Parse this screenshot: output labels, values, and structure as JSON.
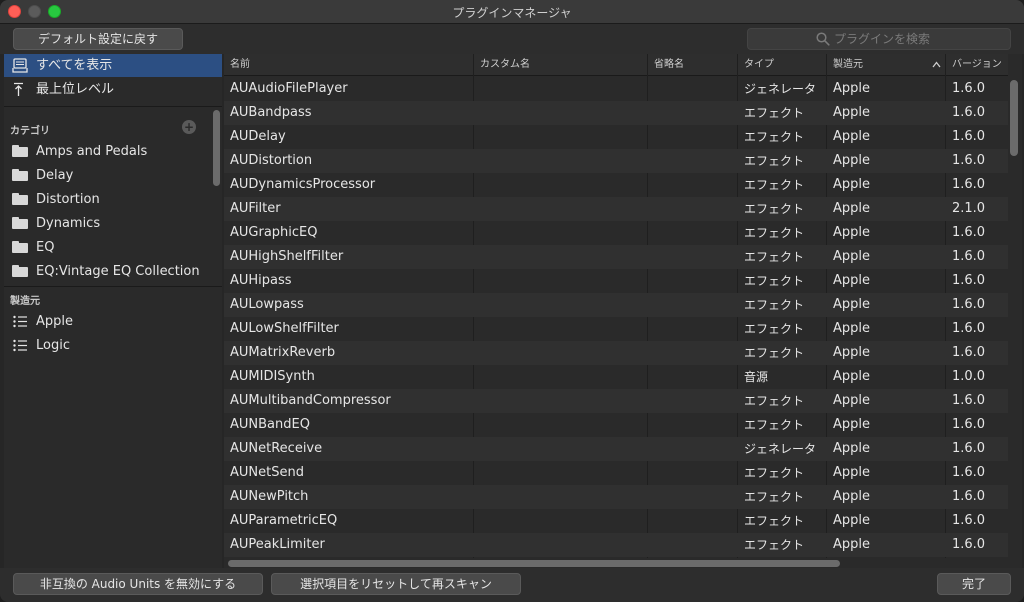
{
  "window": {
    "title": "プラグインマネージャ"
  },
  "toolbar": {
    "reset_label": "デフォルト設定に戻す",
    "search_placeholder": "プラグインを検索"
  },
  "sidebar": {
    "show_all": "すべてを表示",
    "top_level": "最上位レベル",
    "category_header": "カテゴリ",
    "categories": [
      "Amps and Pedals",
      "Delay",
      "Distortion",
      "Dynamics",
      "EQ",
      "EQ:Vintage EQ Collection"
    ],
    "manufacturer_header": "製造元",
    "manufacturers": [
      "Apple",
      "Logic"
    ]
  },
  "table": {
    "columns": [
      "名前",
      "カスタム名",
      "省略名",
      "タイプ",
      "製造元",
      "バージョン"
    ],
    "rows": [
      {
        "name": "AUAudioFilePlayer",
        "type": "ジェネレータ",
        "mfr": "Apple",
        "ver": "1.6.0"
      },
      {
        "name": "AUBandpass",
        "type": "エフェクト",
        "mfr": "Apple",
        "ver": "1.6.0"
      },
      {
        "name": "AUDelay",
        "type": "エフェクト",
        "mfr": "Apple",
        "ver": "1.6.0"
      },
      {
        "name": "AUDistortion",
        "type": "エフェクト",
        "mfr": "Apple",
        "ver": "1.6.0"
      },
      {
        "name": "AUDynamicsProcessor",
        "type": "エフェクト",
        "mfr": "Apple",
        "ver": "1.6.0"
      },
      {
        "name": "AUFilter",
        "type": "エフェクト",
        "mfr": "Apple",
        "ver": "2.1.0"
      },
      {
        "name": "AUGraphicEQ",
        "type": "エフェクト",
        "mfr": "Apple",
        "ver": "1.6.0"
      },
      {
        "name": "AUHighShelfFilter",
        "type": "エフェクト",
        "mfr": "Apple",
        "ver": "1.6.0"
      },
      {
        "name": "AUHipass",
        "type": "エフェクト",
        "mfr": "Apple",
        "ver": "1.6.0"
      },
      {
        "name": "AULowpass",
        "type": "エフェクト",
        "mfr": "Apple",
        "ver": "1.6.0"
      },
      {
        "name": "AULowShelfFilter",
        "type": "エフェクト",
        "mfr": "Apple",
        "ver": "1.6.0"
      },
      {
        "name": "AUMatrixReverb",
        "type": "エフェクト",
        "mfr": "Apple",
        "ver": "1.6.0"
      },
      {
        "name": "AUMIDISynth",
        "type": "音源",
        "mfr": "Apple",
        "ver": "1.0.0"
      },
      {
        "name": "AUMultibandCompressor",
        "type": "エフェクト",
        "mfr": "Apple",
        "ver": "1.6.0"
      },
      {
        "name": "AUNBandEQ",
        "type": "エフェクト",
        "mfr": "Apple",
        "ver": "1.6.0"
      },
      {
        "name": "AUNetReceive",
        "type": "ジェネレータ",
        "mfr": "Apple",
        "ver": "1.6.0"
      },
      {
        "name": "AUNetSend",
        "type": "エフェクト",
        "mfr": "Apple",
        "ver": "1.6.0"
      },
      {
        "name": "AUNewPitch",
        "type": "エフェクト",
        "mfr": "Apple",
        "ver": "1.6.0"
      },
      {
        "name": "AUParametricEQ",
        "type": "エフェクト",
        "mfr": "Apple",
        "ver": "1.6.0"
      },
      {
        "name": "AUPeakLimiter",
        "type": "エフェクト",
        "mfr": "Apple",
        "ver": "1.6.0"
      }
    ]
  },
  "bottom": {
    "disable_incompatible": "非互換の Audio Units を無効にする",
    "reset_rescan": "選択項目をリセットして再スキャン",
    "done": "完了"
  }
}
